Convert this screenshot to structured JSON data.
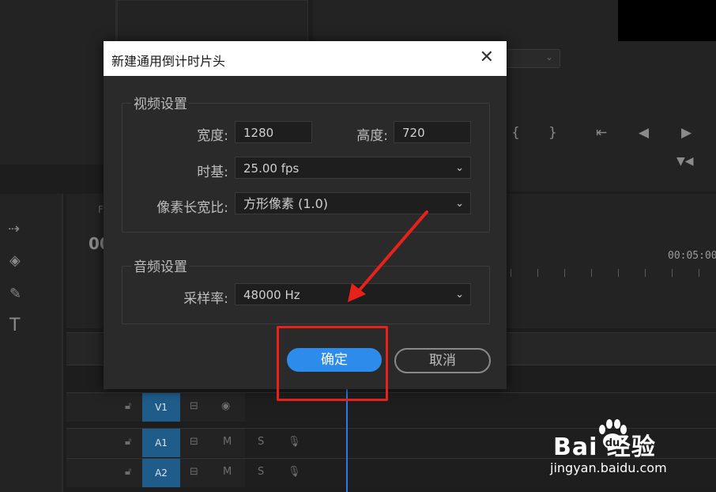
{
  "dialog": {
    "title": "新建通用倒计时片头",
    "video_group": "视频设置",
    "width_label": "宽度:",
    "width_value": "1280",
    "height_label": "高度:",
    "height_value": "720",
    "timebase_label": "时基:",
    "timebase_value": "25.00 fps",
    "pixel_aspect_label": "像素长宽比:",
    "pixel_aspect_value": "方形像素 (1.0)",
    "audio_group": "音频设置",
    "sample_rate_label": "采样率:",
    "sample_rate_value": "48000 Hz",
    "ok_label": "确定",
    "cancel_label": "取消"
  },
  "background": {
    "timecode": "00:05:00",
    "timeline_big_digits": "00",
    "timeline_small": "F",
    "tracks": [
      {
        "name": "V1",
        "icons": [
          "lock-icon",
          "toggle-sync-icon",
          "eye-icon"
        ]
      },
      {
        "name": "A1",
        "icons": [
          "lock-icon",
          "toggle-sync-icon",
          "M",
          "S",
          "mic-icon"
        ]
      },
      {
        "name": "A2",
        "icons": [
          "lock-icon",
          "toggle-sync-icon",
          "M",
          "S",
          "mic-icon"
        ]
      }
    ]
  },
  "watermark": {
    "logo": "Bai  经验",
    "url": "jingyan.baidu.com"
  },
  "colors": {
    "accent": "#2d8ceb",
    "highlight": "#e8221b",
    "track_label": "#1f5c8a"
  }
}
